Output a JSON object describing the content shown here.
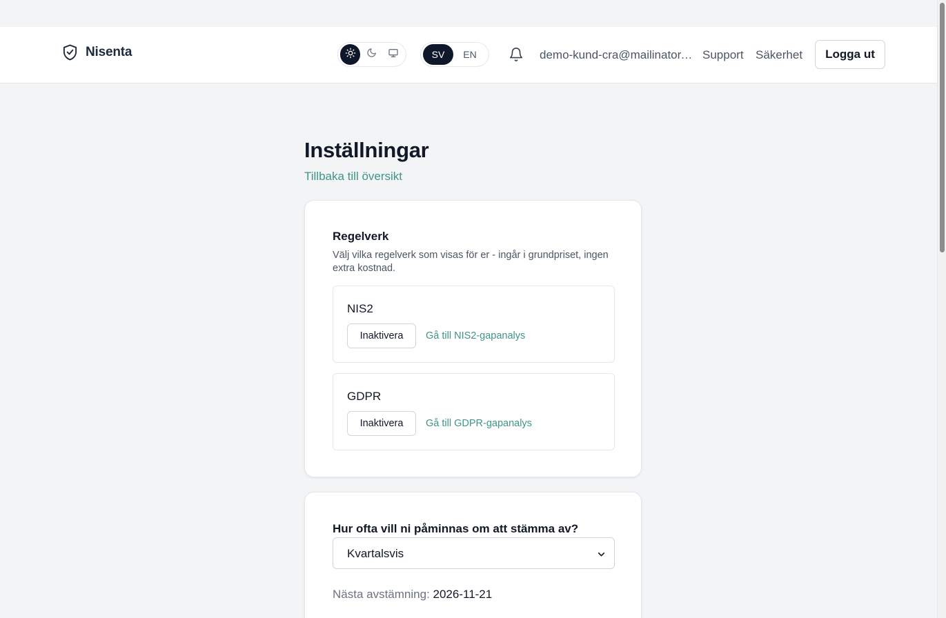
{
  "header": {
    "brand": "Nisenta",
    "theme_options": [
      "light",
      "dark",
      "system"
    ],
    "theme_selected": "light",
    "languages": [
      "SV",
      "EN"
    ],
    "language_selected": "SV",
    "user_email": "demo-kund-cra@mailinator.com",
    "support_label": "Support",
    "security_label": "Säkerhet",
    "logout_label": "Logga ut"
  },
  "page": {
    "title": "Inställningar",
    "back_link": "Tillbaka till översikt"
  },
  "frameworks": {
    "title": "Regelverk",
    "description": "Välj vilka regelverk som visas för er - ingår i grundpriset, ingen extra kostnad.",
    "items": [
      {
        "name": "NIS2",
        "button_label": "Inaktivera",
        "link_label": "Gå till NIS2-gapanalys"
      },
      {
        "name": "GDPR",
        "button_label": "Inaktivera",
        "link_label": "Gå till GDPR-gapanalys"
      }
    ]
  },
  "reminder": {
    "question": "Hur ofta vill ni påminnas om att stämma av?",
    "selected": "Kvartalsvis",
    "next_label": "Nästa avstämning:",
    "next_date": "2026-11-21"
  },
  "colors": {
    "accent": "#3f9487",
    "dark": "#0f172a",
    "background": "#f3f4f6"
  }
}
